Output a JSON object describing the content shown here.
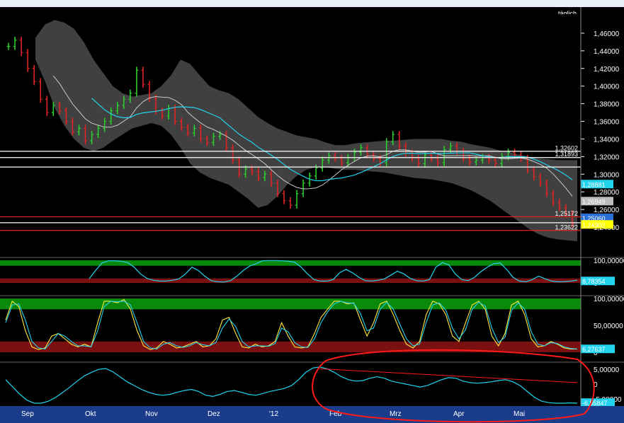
{
  "window": {
    "timeframe_label": "täglich"
  },
  "colors": {
    "background": "#000000",
    "price_up": "#2ecc2e",
    "price_down": "#e02424",
    "bollinger_band": "#555555",
    "sma_fast": "#22d3ee",
    "sma_slow": "#c8c8c8",
    "rsi_line": "#22d3ee",
    "stoch_k": "#ffeb3b",
    "stoch_d": "#22d3ee",
    "overbought_zone": "#0a8a0a",
    "oversold_zone": "#7a1010",
    "annotation": "#ff1a1a"
  },
  "chart_data": [
    {
      "type": "line",
      "panel": "price",
      "style": "ohlc-bars with bollinger bands and moving averages",
      "ylim": [
        1.22,
        1.48
      ],
      "y_ticks": [
        "1,46000",
        "1,44000",
        "1,42000",
        "1,40000",
        "1,38000",
        "1,36000",
        "1,34000",
        "1,32000",
        "1,30000",
        "1,28000",
        "1,26000",
        "1,24000"
      ],
      "y_tick_values": [
        1.46,
        1.44,
        1.42,
        1.4,
        1.38,
        1.36,
        1.34,
        1.32,
        1.3,
        1.28,
        1.26,
        1.24
      ],
      "x_labels": [
        "Sep",
        "Okt",
        "Nov",
        "Dez",
        "'12",
        "Feb",
        "Mrz",
        "Apr",
        "Mai"
      ],
      "close": [
        1.445,
        1.452,
        1.438,
        1.42,
        1.405,
        1.385,
        1.37,
        1.378,
        1.372,
        1.36,
        1.348,
        1.352,
        1.338,
        1.345,
        1.352,
        1.36,
        1.372,
        1.378,
        1.385,
        1.392,
        1.418,
        1.402,
        1.386,
        1.372,
        1.366,
        1.375,
        1.36,
        1.353,
        1.347,
        1.352,
        1.34,
        1.336,
        1.343,
        1.345,
        1.33,
        1.316,
        1.3,
        1.306,
        1.303,
        1.296,
        1.3,
        1.29,
        1.278,
        1.27,
        1.265,
        1.278,
        1.29,
        1.298,
        1.307,
        1.316,
        1.321,
        1.318,
        1.313,
        1.319,
        1.325,
        1.33,
        1.322,
        1.318,
        1.313,
        1.337,
        1.345,
        1.332,
        1.324,
        1.318,
        1.312,
        1.322,
        1.318,
        1.313,
        1.328,
        1.332,
        1.326,
        1.318,
        1.314,
        1.316,
        1.319,
        1.316,
        1.312,
        1.32,
        1.325,
        1.322,
        1.318,
        1.305,
        1.297,
        1.29,
        1.278,
        1.268,
        1.262,
        1.255,
        1.244
      ],
      "upper_band": [
        1.455,
        1.47,
        1.475,
        1.472,
        1.465,
        1.45,
        1.43,
        1.415,
        1.4,
        1.392,
        1.388,
        1.39,
        1.392,
        1.4,
        1.412,
        1.43,
        1.425,
        1.412,
        1.4,
        1.395,
        1.392,
        1.385,
        1.375,
        1.365,
        1.358,
        1.352,
        1.348,
        1.344,
        1.342,
        1.34,
        1.336,
        1.333,
        1.333,
        1.335,
        1.336,
        1.337,
        1.338,
        1.338,
        1.339,
        1.34,
        1.34,
        1.34,
        1.34,
        1.338,
        1.337,
        1.334,
        1.332,
        1.33,
        1.327,
        1.325,
        1.322,
        1.32,
        1.318,
        1.317,
        1.316,
        1.316,
        1.316
      ],
      "lower_band": [
        1.43,
        1.405,
        1.375,
        1.355,
        1.34,
        1.33,
        1.326,
        1.33,
        1.338,
        1.345,
        1.352,
        1.355,
        1.358,
        1.355,
        1.345,
        1.33,
        1.312,
        1.302,
        1.296,
        1.292,
        1.288,
        1.28,
        1.272,
        1.262,
        1.265,
        1.275,
        1.288,
        1.298,
        1.305,
        1.308,
        1.308,
        1.306,
        1.305,
        1.305,
        1.304,
        1.303,
        1.302,
        1.3,
        1.298,
        1.296,
        1.295,
        1.294,
        1.292,
        1.29,
        1.286,
        1.282,
        1.276,
        1.27,
        1.262,
        1.254,
        1.246,
        1.238,
        1.232,
        1.228,
        1.226,
        1.225,
        1.224
      ],
      "horizontal_levels": [
        {
          "value": 1.32602,
          "label": "1,32602",
          "color": "#ffffff"
        },
        {
          "value": 1.31893,
          "label": "1,31893",
          "color": "#ffffff"
        },
        {
          "value": 1.3082,
          "label": "",
          "color": "#ffffff"
        },
        {
          "value": 1.25172,
          "label": "1,25172",
          "color": "#e02424"
        },
        {
          "value": 1.245,
          "label": "",
          "color": "#ffffff"
        },
        {
          "value": 1.23622,
          "label": "1,23622",
          "color": "#e02424"
        }
      ],
      "price_boxes": [
        {
          "value": 1.28881,
          "label": "1,28881",
          "bg": "#22d3ee",
          "fg": "#000000"
        },
        {
          "value": 1.26949,
          "label": "1,26949",
          "bg": "#bdbdbd",
          "fg": "#000000"
        },
        {
          "value": 1.2506,
          "label": "1,25060",
          "bg": "#2a6fd6",
          "fg": "#ffffff"
        },
        {
          "value": 1.24302,
          "label": "1,24302",
          "bg": "#ffff00",
          "fg": "#000000"
        }
      ]
    },
    {
      "type": "line",
      "panel": "rsi-1",
      "ylim": [
        0,
        100
      ],
      "y_ticks": [
        "100,00000",
        "0"
      ],
      "current_value_label": "8,78354",
      "values": [
        null,
        null,
        null,
        null,
        null,
        null,
        null,
        null,
        null,
        null,
        null,
        null,
        null,
        18,
        55,
        88,
        98,
        98,
        96,
        90,
        70,
        40,
        20,
        12,
        8,
        8,
        12,
        18,
        40,
        70,
        55,
        30,
        10,
        5,
        4,
        10,
        30,
        55,
        75,
        85,
        98,
        99,
        99,
        98,
        96,
        92,
        70,
        40,
        15,
        8,
        8,
        15,
        45,
        60,
        45,
        25,
        10,
        8,
        12,
        18,
        35,
        52,
        40,
        20,
        10,
        8,
        15,
        70,
        90,
        80,
        40,
        15,
        10,
        25,
        50,
        70,
        85,
        88,
        60,
        25,
        8,
        5,
        15,
        30,
        18,
        8,
        5,
        6,
        8,
        12
      ]
    },
    {
      "type": "line",
      "panel": "stochastic",
      "ylim": [
        0,
        100
      ],
      "y_ticks": [
        "100,00000",
        "50,00000",
        "0"
      ],
      "current_value_label": "6,27637",
      "series": [
        {
          "values": [
            60,
            95,
            85,
            40,
            10,
            5,
            8,
            30,
            35,
            25,
            15,
            10,
            15,
            10,
            55,
            95,
            95,
            92,
            98,
            80,
            40,
            12,
            5,
            8,
            20,
            15,
            8,
            10,
            15,
            20,
            10,
            12,
            25,
            60,
            65,
            35,
            10,
            8,
            15,
            10,
            12,
            20,
            55,
            30,
            10,
            8,
            10,
            35,
            65,
            80,
            95,
            95,
            90,
            92,
            60,
            30,
            55,
            90,
            95,
            70,
            40,
            15,
            8,
            20,
            70,
            95,
            90,
            70,
            30,
            20,
            55,
            88,
            95,
            80,
            30,
            12,
            35,
            88,
            95,
            70,
            25,
            10,
            12,
            20,
            15,
            8,
            6,
            6
          ]
        },
        {
          "values": [
            55,
            88,
            90,
            60,
            20,
            8,
            6,
            20,
            35,
            30,
            20,
            12,
            12,
            10,
            40,
            85,
            95,
            94,
            95,
            88,
            55,
            20,
            8,
            6,
            15,
            18,
            12,
            9,
            12,
            18,
            14,
            12,
            18,
            45,
            62,
            48,
            20,
            10,
            12,
            12,
            11,
            16,
            45,
            38,
            18,
            10,
            9,
            25,
            55,
            75,
            90,
            95,
            92,
            91,
            72,
            40,
            45,
            80,
            93,
            80,
            52,
            25,
            12,
            15,
            55,
            88,
            92,
            78,
            45,
            25,
            42,
            80,
            93,
            86,
            45,
            18,
            28,
            78,
            92,
            80,
            38,
            15,
            12,
            18,
            16,
            10,
            7,
            6
          ]
        }
      ]
    },
    {
      "type": "line",
      "panel": "oscillator",
      "ylim": [
        -6.5,
        6.5
      ],
      "y_ticks": [
        "5,00000",
        "0",
        "-5,00000"
      ],
      "current_value_label": "-6,55847",
      "values": [
        1.5,
        -1.0,
        -3.5,
        -5.5,
        -6.5,
        -6.5,
        -5.8,
        -4.5,
        -2.8,
        -1.0,
        1.0,
        2.8,
        4.0,
        5.0,
        5.3,
        4.2,
        2.5,
        0.8,
        -0.5,
        -1.8,
        -2.8,
        -3.5,
        -3.8,
        -3.5,
        -2.8,
        -2.2,
        -1.8,
        -2.5,
        -3.8,
        -4.2,
        -3.5,
        -2.5,
        -2.2,
        -2.8,
        -3.5,
        -3.8,
        -3.2,
        -2.5,
        -2.0,
        -1.5,
        -0.5,
        1.5,
        4.0,
        5.5,
        5.8,
        5.2,
        4.0,
        2.5,
        1.5,
        1.0,
        1.2,
        2.0,
        2.5,
        2.0,
        1.0,
        0.5,
        0.0,
        -0.5,
        -1.0,
        -0.5,
        0.5,
        1.5,
        2.2,
        2.0,
        1.0,
        0.5,
        0.3,
        0.5,
        0.8,
        1.2,
        1.5,
        0.8,
        -0.5,
        -2.5,
        -4.5,
        -5.8,
        -6.3,
        -6.5,
        -6.5,
        -6.4,
        -6.5
      ],
      "trendline": {
        "from": 5.2,
        "to": 0.5
      }
    }
  ]
}
